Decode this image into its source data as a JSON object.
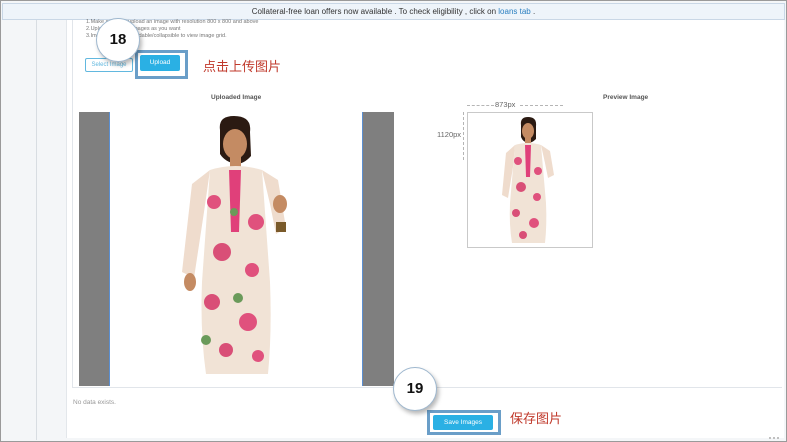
{
  "banner": {
    "message": "Collateral-free loan offers now available . To check eligibility , click on",
    "link_text": "loans tab",
    "suffix": "."
  },
  "instructions": {
    "line1": "1.Make sure you upload an image with resolution 800 x 800 and above",
    "line2": "2.Upload as many images as you want",
    "line3": "3.Image grid is expandable/collapsible to view image grid."
  },
  "upload_controls": {
    "select_label": "Select Image",
    "upload_label": "Upload"
  },
  "callouts": {
    "step_upload": "18",
    "step_save": "19"
  },
  "annotations": {
    "upload_cn": "点击上传图片",
    "save_cn": "保存图片"
  },
  "sections": {
    "uploaded_title": "Uploaded Image",
    "preview_title": "Preview Image"
  },
  "preview": {
    "width_label": "873px",
    "height_label": "1120px"
  },
  "status": {
    "no_data": "No data exists."
  },
  "actions": {
    "save_label": "Save Images"
  },
  "colors": {
    "accent": "#2ab0e4",
    "callout_border": "#6a9ec8",
    "annotation_red": "#c0392b"
  },
  "icons": {
    "resize": "resize-grip-icon"
  }
}
